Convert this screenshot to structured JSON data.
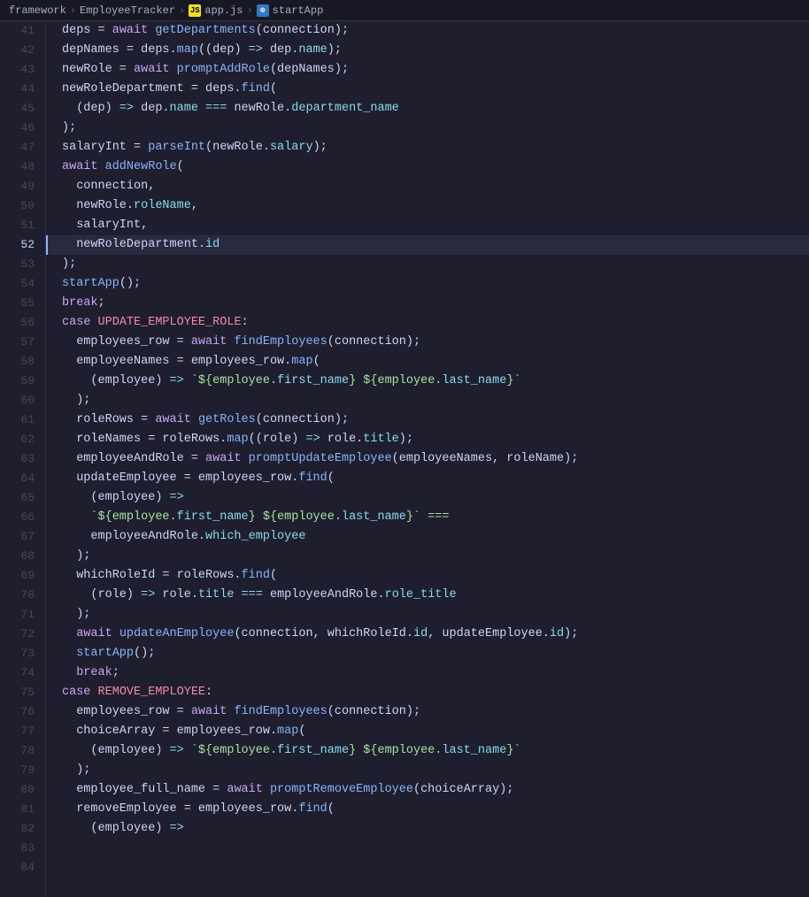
{
  "breadcrumb": {
    "items": [
      {
        "label": "framework",
        "type": "folder"
      },
      {
        "label": "EmployeeTracker",
        "type": "folder"
      },
      {
        "label": "app.js",
        "type": "js",
        "icon": "js"
      },
      {
        "label": "startApp",
        "type": "function",
        "icon": "ts"
      }
    ]
  },
  "editor": {
    "lines": [
      {
        "num": 41,
        "active": false,
        "content": [
          {
            "t": "deps = ",
            "c": "var"
          },
          {
            "t": "await ",
            "c": "kw"
          },
          {
            "t": "getDepartments",
            "c": "fn"
          },
          {
            "t": "(connection);",
            "c": "plain"
          }
        ]
      },
      {
        "num": 42,
        "active": false,
        "content": [
          {
            "t": "depNames = deps.",
            "c": "var"
          },
          {
            "t": "map",
            "c": "fn"
          },
          {
            "t": "((dep) ",
            "c": "plain"
          },
          {
            "t": "=>",
            "c": "arrow"
          },
          {
            "t": " dep.",
            "c": "plain"
          },
          {
            "t": "name",
            "c": "prop"
          },
          {
            "t": ");",
            "c": "plain"
          }
        ]
      },
      {
        "num": 43,
        "active": false,
        "content": [
          {
            "t": "newRole = ",
            "c": "var"
          },
          {
            "t": "await ",
            "c": "kw"
          },
          {
            "t": "promptAddRole",
            "c": "fn"
          },
          {
            "t": "(depNames);",
            "c": "plain"
          }
        ]
      },
      {
        "num": 44,
        "active": false,
        "content": [
          {
            "t": "newRoleDepartment = deps.",
            "c": "var"
          },
          {
            "t": "find",
            "c": "fn"
          },
          {
            "t": "(",
            "c": "plain"
          }
        ]
      },
      {
        "num": 45,
        "active": false,
        "content": [
          {
            "t": "  (dep) ",
            "c": "plain"
          },
          {
            "t": "=>",
            "c": "arrow"
          },
          {
            "t": " dep.",
            "c": "plain"
          },
          {
            "t": "name",
            "c": "prop"
          },
          {
            "t": " === ",
            "c": "op"
          },
          {
            "t": "newRole.",
            "c": "var"
          },
          {
            "t": "department_name",
            "c": "prop"
          }
        ]
      },
      {
        "num": 46,
        "active": false,
        "content": [
          {
            "t": ");",
            "c": "plain"
          }
        ]
      },
      {
        "num": 47,
        "active": false,
        "content": [
          {
            "t": "salaryInt = ",
            "c": "var"
          },
          {
            "t": "parseInt",
            "c": "fn"
          },
          {
            "t": "(newRole.",
            "c": "plain"
          },
          {
            "t": "salary",
            "c": "prop"
          },
          {
            "t": ");",
            "c": "plain"
          }
        ]
      },
      {
        "num": 48,
        "active": false,
        "content": [
          {
            "t": "await ",
            "c": "kw"
          },
          {
            "t": "addNewRole",
            "c": "fn"
          },
          {
            "t": "(",
            "c": "plain"
          }
        ]
      },
      {
        "num": 49,
        "active": false,
        "content": [
          {
            "t": "  connection,",
            "c": "plain"
          }
        ]
      },
      {
        "num": 50,
        "active": false,
        "content": [
          {
            "t": "  newRole.",
            "c": "var"
          },
          {
            "t": "roleName",
            "c": "prop"
          },
          {
            "t": ",",
            "c": "plain"
          }
        ]
      },
      {
        "num": 51,
        "active": false,
        "content": [
          {
            "t": "  salaryInt,",
            "c": "plain"
          }
        ]
      },
      {
        "num": 52,
        "active": true,
        "content": [
          {
            "t": "  newRoleDepartment.",
            "c": "var"
          },
          {
            "t": "id",
            "c": "prop"
          }
        ]
      },
      {
        "num": 53,
        "active": false,
        "content": [
          {
            "t": ");",
            "c": "plain"
          }
        ]
      },
      {
        "num": 54,
        "active": false,
        "content": [
          {
            "t": "startApp",
            "c": "fn"
          },
          {
            "t": "();",
            "c": "plain"
          }
        ]
      },
      {
        "num": 55,
        "active": false,
        "content": [
          {
            "t": "break",
            "c": "brk"
          },
          {
            "t": ";",
            "c": "plain"
          }
        ]
      },
      {
        "num": 56,
        "active": false,
        "content": []
      },
      {
        "num": 57,
        "active": false,
        "content": [
          {
            "t": "case ",
            "c": "kw"
          },
          {
            "t": "UPDATE_EMPLOYEE_ROLE",
            "c": "const-name"
          },
          {
            "t": ":",
            "c": "plain"
          }
        ]
      },
      {
        "num": 58,
        "active": false,
        "content": [
          {
            "t": "  employees_row = ",
            "c": "var"
          },
          {
            "t": "await ",
            "c": "kw"
          },
          {
            "t": "findEmployees",
            "c": "fn"
          },
          {
            "t": "(connection);",
            "c": "plain"
          }
        ]
      },
      {
        "num": 59,
        "active": false,
        "content": [
          {
            "t": "  employeeNames = employees_row.",
            "c": "var"
          },
          {
            "t": "map",
            "c": "fn"
          },
          {
            "t": "(",
            "c": "plain"
          }
        ]
      },
      {
        "num": 60,
        "active": false,
        "content": [
          {
            "t": "    (employee) ",
            "c": "plain"
          },
          {
            "t": "=>",
            "c": "arrow"
          },
          {
            "t": " `${employee.",
            "c": "tmpl"
          },
          {
            "t": "first_name",
            "c": "prop"
          },
          {
            "t": "} ${employee.",
            "c": "tmpl"
          },
          {
            "t": "last_name",
            "c": "prop"
          },
          {
            "t": "}`",
            "c": "tmpl"
          }
        ]
      },
      {
        "num": 61,
        "active": false,
        "content": [
          {
            "t": "  );",
            "c": "plain"
          }
        ]
      },
      {
        "num": 62,
        "active": false,
        "content": [
          {
            "t": "  roleRows = ",
            "c": "var"
          },
          {
            "t": "await ",
            "c": "kw"
          },
          {
            "t": "getRoles",
            "c": "fn"
          },
          {
            "t": "(connection);",
            "c": "plain"
          }
        ]
      },
      {
        "num": 63,
        "active": false,
        "content": [
          {
            "t": "  roleNames = roleRows.",
            "c": "var"
          },
          {
            "t": "map",
            "c": "fn"
          },
          {
            "t": "((role) ",
            "c": "plain"
          },
          {
            "t": "=>",
            "c": "arrow"
          },
          {
            "t": " role.",
            "c": "plain"
          },
          {
            "t": "title",
            "c": "prop"
          },
          {
            "t": ");",
            "c": "plain"
          }
        ]
      },
      {
        "num": 64,
        "active": false,
        "content": [
          {
            "t": "  employeeAndRole = ",
            "c": "var"
          },
          {
            "t": "await ",
            "c": "kw"
          },
          {
            "t": "promptUpdateEmployee",
            "c": "fn"
          },
          {
            "t": "(employeeNames, roleName);",
            "c": "plain"
          }
        ]
      },
      {
        "num": 65,
        "active": false,
        "content": [
          {
            "t": "  updateEmployee = employees_row.",
            "c": "var"
          },
          {
            "t": "find",
            "c": "fn"
          },
          {
            "t": "(",
            "c": "plain"
          }
        ]
      },
      {
        "num": 66,
        "active": false,
        "content": [
          {
            "t": "    (employee) ",
            "c": "plain"
          },
          {
            "t": "=>",
            "c": "arrow"
          }
        ]
      },
      {
        "num": 67,
        "active": false,
        "content": [
          {
            "t": "    `${employee.",
            "c": "tmpl"
          },
          {
            "t": "first_name",
            "c": "prop"
          },
          {
            "t": "} ${employee.",
            "c": "tmpl"
          },
          {
            "t": "last_name",
            "c": "prop"
          },
          {
            "t": "}` ===",
            "c": "tmpl"
          }
        ]
      },
      {
        "num": 68,
        "active": false,
        "content": [
          {
            "t": "    employeeAndRole.",
            "c": "var"
          },
          {
            "t": "which_employee",
            "c": "prop"
          }
        ]
      },
      {
        "num": 69,
        "active": false,
        "content": [
          {
            "t": "  );",
            "c": "plain"
          }
        ]
      },
      {
        "num": 70,
        "active": false,
        "content": [
          {
            "t": "  whichRoleId = roleRows.",
            "c": "var"
          },
          {
            "t": "find",
            "c": "fn"
          },
          {
            "t": "(",
            "c": "plain"
          }
        ]
      },
      {
        "num": 71,
        "active": false,
        "content": [
          {
            "t": "    (role) ",
            "c": "plain"
          },
          {
            "t": "=>",
            "c": "arrow"
          },
          {
            "t": " role.",
            "c": "plain"
          },
          {
            "t": "title",
            "c": "prop"
          },
          {
            "t": " === ",
            "c": "op"
          },
          {
            "t": "employeeAndRole.",
            "c": "var"
          },
          {
            "t": "role_title",
            "c": "prop"
          }
        ]
      },
      {
        "num": 72,
        "active": false,
        "content": [
          {
            "t": "  );",
            "c": "plain"
          }
        ]
      },
      {
        "num": 73,
        "active": false,
        "content": [
          {
            "t": "  await ",
            "c": "kw"
          },
          {
            "t": "updateAnEmployee",
            "c": "fn"
          },
          {
            "t": "(connection, whichRoleId.",
            "c": "plain"
          },
          {
            "t": "id",
            "c": "prop"
          },
          {
            "t": ", updateEmployee.",
            "c": "plain"
          },
          {
            "t": "id",
            "c": "prop"
          },
          {
            "t": ");",
            "c": "plain"
          }
        ]
      },
      {
        "num": 74,
        "active": false,
        "content": [
          {
            "t": "  startApp",
            "c": "fn"
          },
          {
            "t": "();",
            "c": "plain"
          }
        ]
      },
      {
        "num": 75,
        "active": false,
        "content": [
          {
            "t": "  break",
            "c": "brk"
          },
          {
            "t": ";",
            "c": "plain"
          }
        ]
      },
      {
        "num": 76,
        "active": false,
        "content": []
      },
      {
        "num": 77,
        "active": false,
        "content": [
          {
            "t": "case ",
            "c": "kw"
          },
          {
            "t": "REMOVE_EMPLOYEE",
            "c": "const-name"
          },
          {
            "t": ":",
            "c": "plain"
          }
        ]
      },
      {
        "num": 78,
        "active": false,
        "content": [
          {
            "t": "  employees_row = ",
            "c": "var"
          },
          {
            "t": "await ",
            "c": "kw"
          },
          {
            "t": "findEmployees",
            "c": "fn"
          },
          {
            "t": "(connection);",
            "c": "plain"
          }
        ]
      },
      {
        "num": 79,
        "active": false,
        "content": [
          {
            "t": "  choiceArray = employees_row.",
            "c": "var"
          },
          {
            "t": "map",
            "c": "fn"
          },
          {
            "t": "(",
            "c": "plain"
          }
        ]
      },
      {
        "num": 80,
        "active": false,
        "content": [
          {
            "t": "    (employee) ",
            "c": "plain"
          },
          {
            "t": "=>",
            "c": "arrow"
          },
          {
            "t": " `${employee.",
            "c": "tmpl"
          },
          {
            "t": "first_name",
            "c": "prop"
          },
          {
            "t": "} ${employee.",
            "c": "tmpl"
          },
          {
            "t": "last_name",
            "c": "prop"
          },
          {
            "t": "}`",
            "c": "tmpl"
          }
        ]
      },
      {
        "num": 81,
        "active": false,
        "content": [
          {
            "t": "  );",
            "c": "plain"
          }
        ]
      },
      {
        "num": 82,
        "active": false,
        "content": [
          {
            "t": "  employee_full_name = ",
            "c": "var"
          },
          {
            "t": "await ",
            "c": "kw"
          },
          {
            "t": "promptRemoveEmployee",
            "c": "fn"
          },
          {
            "t": "(choiceArray);",
            "c": "plain"
          }
        ]
      },
      {
        "num": 83,
        "active": false,
        "content": [
          {
            "t": "  removeEmployee = employees_row.",
            "c": "var"
          },
          {
            "t": "find",
            "c": "fn"
          },
          {
            "t": "(",
            "c": "plain"
          }
        ]
      },
      {
        "num": 84,
        "active": false,
        "content": [
          {
            "t": "    (employee) ",
            "c": "plain"
          },
          {
            "t": "=>",
            "c": "arrow"
          }
        ]
      }
    ]
  }
}
